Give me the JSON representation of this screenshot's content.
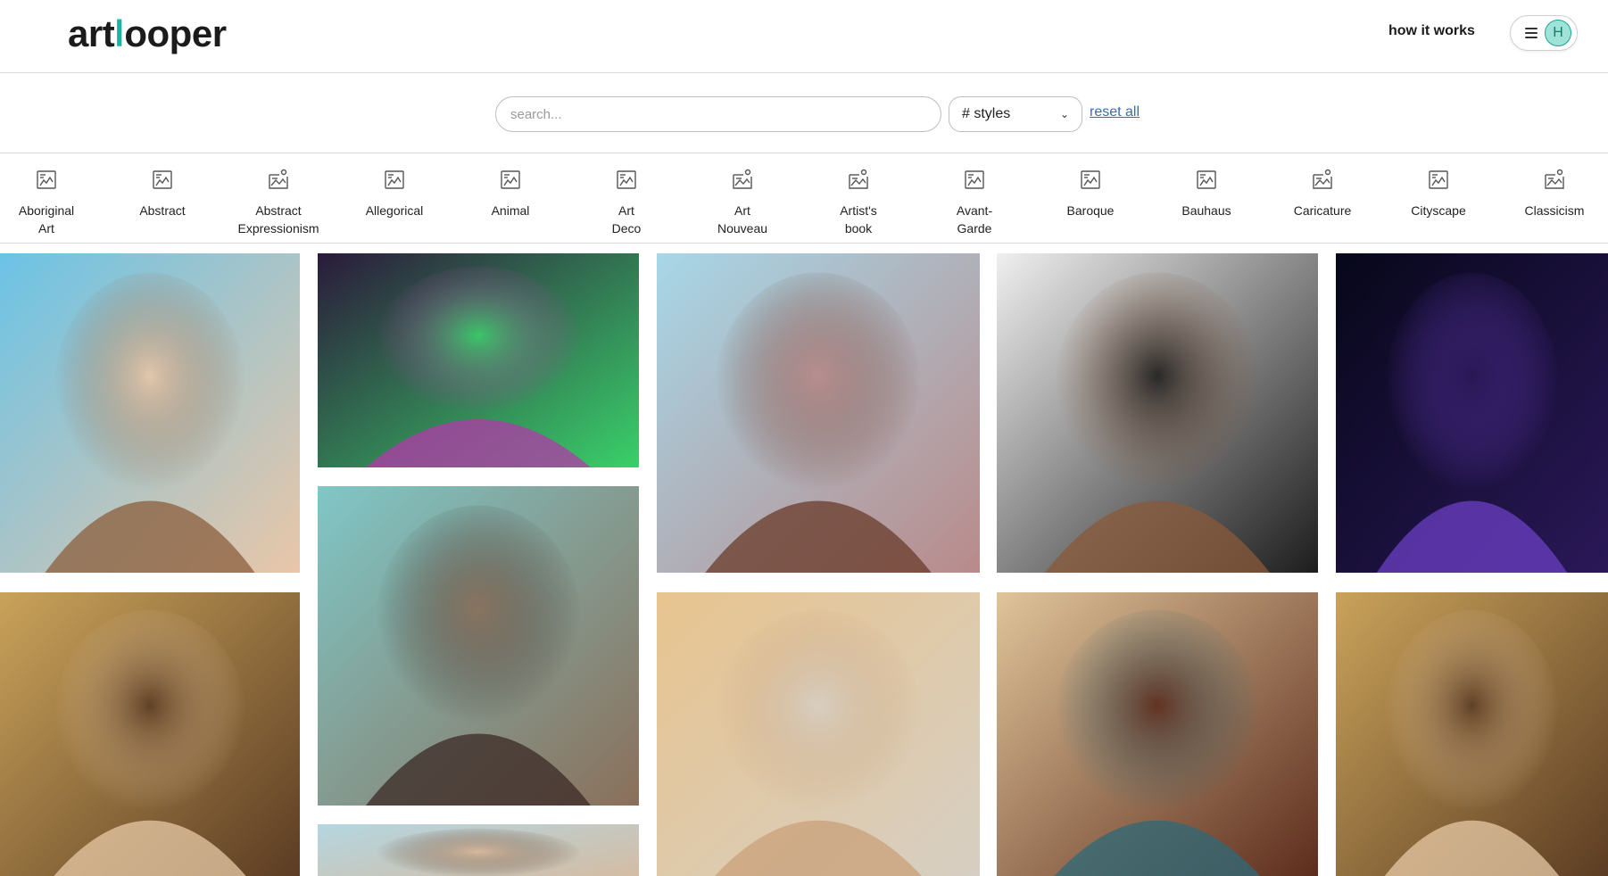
{
  "header": {
    "logo_text_a": "art",
    "logo_text_b": "l",
    "logo_text_c": "ooper",
    "how_it_works": "how it works",
    "avatar_initial": "H"
  },
  "search": {
    "placeholder": "search...",
    "value": "",
    "styles_select": "# styles",
    "reset_all": "reset all"
  },
  "styles": [
    {
      "label": "Aboriginal\nArt",
      "icon": "image-frame-icon"
    },
    {
      "label": "Abstract",
      "icon": "image-frame-icon"
    },
    {
      "label": "Abstract\nExpressionism",
      "icon": "image-landscape-icon"
    },
    {
      "label": "Allegorical",
      "icon": "image-frame-icon"
    },
    {
      "label": "Animal",
      "icon": "image-frame-icon"
    },
    {
      "label": "Art\nDeco",
      "icon": "image-frame-icon"
    },
    {
      "label": "Art\nNouveau",
      "icon": "image-landscape-icon"
    },
    {
      "label": "Artist's\nbook",
      "icon": "image-landscape-icon"
    },
    {
      "label": "Avant-\nGarde",
      "icon": "image-frame-icon"
    },
    {
      "label": "Baroque",
      "icon": "image-frame-icon"
    },
    {
      "label": "Bauhaus",
      "icon": "image-frame-icon"
    },
    {
      "label": "Caricature",
      "icon": "image-landscape-icon"
    },
    {
      "label": "Cityscape",
      "icon": "image-frame-icon"
    },
    {
      "label": "Classicism",
      "icon": "image-landscape-icon"
    }
  ],
  "gallery": [
    {
      "name": "anime-girl-coffee-wind",
      "colors": [
        "#6bc3e6",
        "#8b5e3c",
        "#e9c6a8"
      ]
    },
    {
      "name": "dj-turntable",
      "colors": [
        "#2a1a3a",
        "#b23aa8",
        "#3ad06a"
      ]
    },
    {
      "name": "dark-skin-woman-coffee",
      "colors": [
        "#a7d7e8",
        "#6a3b2a",
        "#b98a8a"
      ]
    },
    {
      "name": "anime-boy-portrait",
      "colors": [
        "#efefef",
        "#8a5a3a",
        "#1d1d1d"
      ]
    },
    {
      "name": "owl-moon-night",
      "colors": [
        "#07071a",
        "#6b3fc4",
        "#2a1858"
      ]
    },
    {
      "name": "anime-girl-cafe-table",
      "colors": [
        "#7fc7c7",
        "#3b2a26",
        "#8a6f5a"
      ]
    },
    {
      "name": "blonde-girl-coffee-cars",
      "colors": [
        "#c9a35a",
        "#e7c9a7",
        "#5a3a22"
      ]
    },
    {
      "name": "girl-long-hair-cup",
      "colors": [
        "#e8c48f",
        "#c9a07a",
        "#d6cfc4"
      ]
    },
    {
      "name": "woman-teal-jacket-coffee",
      "colors": [
        "#e0c49a",
        "#2e6a78",
        "#5a2a1a"
      ]
    },
    {
      "name": "blonde-girl-coffee-cars-2",
      "colors": [
        "#c9a35a",
        "#e7c9a7",
        "#5a3a22"
      ]
    },
    {
      "name": "girl-partial-bottom",
      "colors": [
        "#b5d6e0",
        "#4a3020",
        "#d9b89a"
      ]
    }
  ]
}
